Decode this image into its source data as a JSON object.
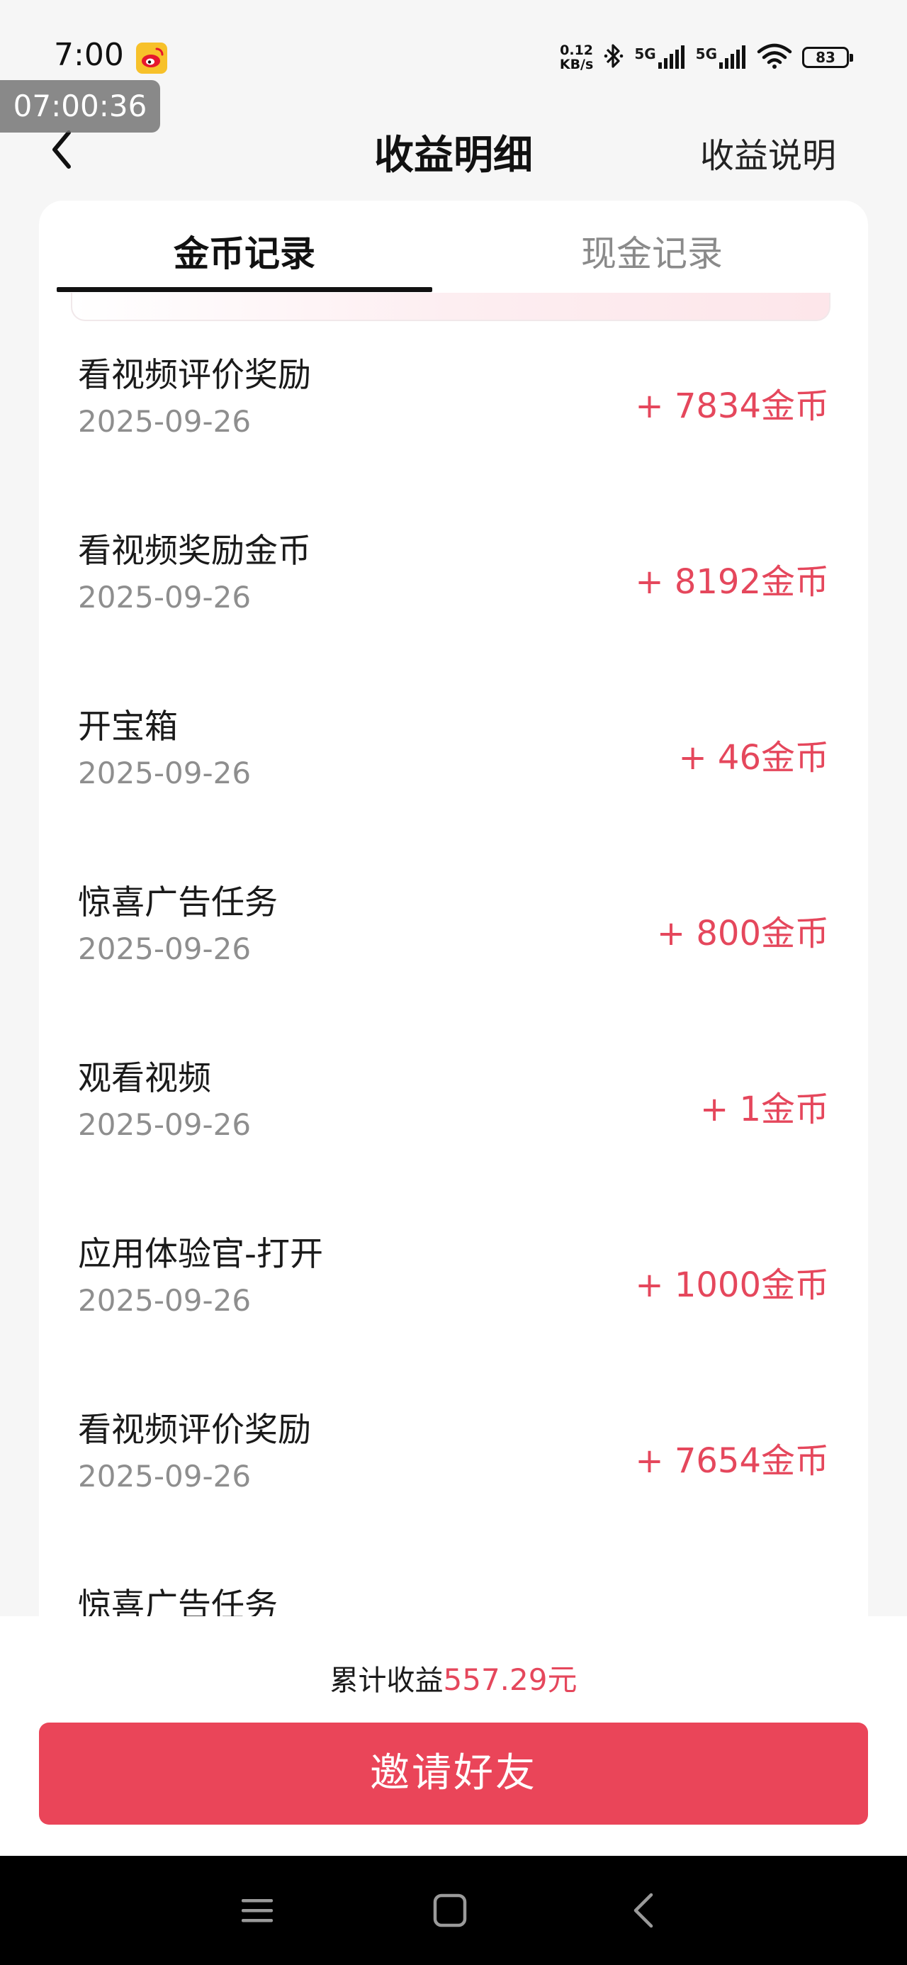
{
  "status_bar": {
    "time": "7:00",
    "net_speed_value": "0.12",
    "net_speed_unit": "KB/s",
    "sim1_label": "5G",
    "sim2_label": "5G",
    "battery_level": "83",
    "recording_time": "07:00:36"
  },
  "nav": {
    "title": "收益明细",
    "right_link": "收益说明"
  },
  "tabs": [
    {
      "label": "金币记录",
      "active": true
    },
    {
      "label": "现金记录",
      "active": false
    }
  ],
  "records": [
    {
      "title": "看视频评价奖励",
      "date": "2025-09-26",
      "amount": "+ 7834金币"
    },
    {
      "title": "看视频奖励金币",
      "date": "2025-09-26",
      "amount": "+ 8192金币"
    },
    {
      "title": "开宝箱",
      "date": "2025-09-26",
      "amount": "+ 46金币"
    },
    {
      "title": "惊喜广告任务",
      "date": "2025-09-26",
      "amount": "+ 800金币"
    },
    {
      "title": "观看视频",
      "date": "2025-09-26",
      "amount": "+ 1金币"
    },
    {
      "title": "应用体验官-打开",
      "date": "2025-09-26",
      "amount": "+ 1000金币"
    },
    {
      "title": "看视频评价奖励",
      "date": "2025-09-26",
      "amount": "+ 7654金币"
    },
    {
      "title": "惊喜广告任务",
      "date": "",
      "amount": ""
    }
  ],
  "footer": {
    "total_label": "累计收益",
    "total_amount": "557.29元",
    "invite_button": "邀请好友"
  },
  "colors": {
    "accent": "#e5475c",
    "button": "#ea4559"
  },
  "icons": {
    "back": "chevron-left-icon",
    "bluetooth": "bluetooth-icon",
    "wifi": "wifi-icon",
    "menu": "menu-icon",
    "home": "home-square-icon",
    "sys_back": "back-triangle-icon"
  }
}
